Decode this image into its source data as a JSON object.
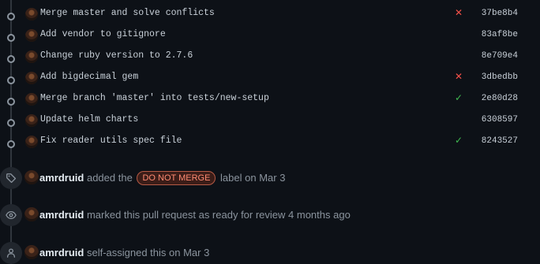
{
  "commits": [
    {
      "message": "Merge master and solve conflicts",
      "status": "fail",
      "sha": "37be8b4"
    },
    {
      "message": "Add vendor to gitignore",
      "status": "none",
      "sha": "83af8be"
    },
    {
      "message": "Change ruby version to 2.7.6",
      "status": "none",
      "sha": "8e709e4"
    },
    {
      "message": "Add bigdecimal gem",
      "status": "fail",
      "sha": "3dbedbb"
    },
    {
      "message": "Merge branch 'master' into tests/new-setup",
      "status": "ok",
      "sha": "2e80d28"
    },
    {
      "message": "Update helm charts",
      "status": "none",
      "sha": "6308597"
    },
    {
      "message": "Fix reader utils spec file",
      "status": "ok",
      "sha": "8243527"
    }
  ],
  "events": {
    "label": {
      "icon": "tag-icon",
      "user": "amrdruid",
      "text_before": "added the",
      "label_name": "DO NOT MERGE",
      "text_after": "label on Mar 3"
    },
    "ready": {
      "icon": "eye-icon",
      "user": "amrdruid",
      "text": "marked this pull request as ready for review 4 months ago"
    },
    "assign": {
      "icon": "person-icon",
      "user": "amrdruid",
      "text": "self-assigned this on Mar 3"
    }
  },
  "colors": {
    "background": "#0d1117",
    "fail": "#f85149",
    "ok": "#3fb950",
    "label_border": "#b65a45",
    "label_text": "#ff8b72"
  }
}
